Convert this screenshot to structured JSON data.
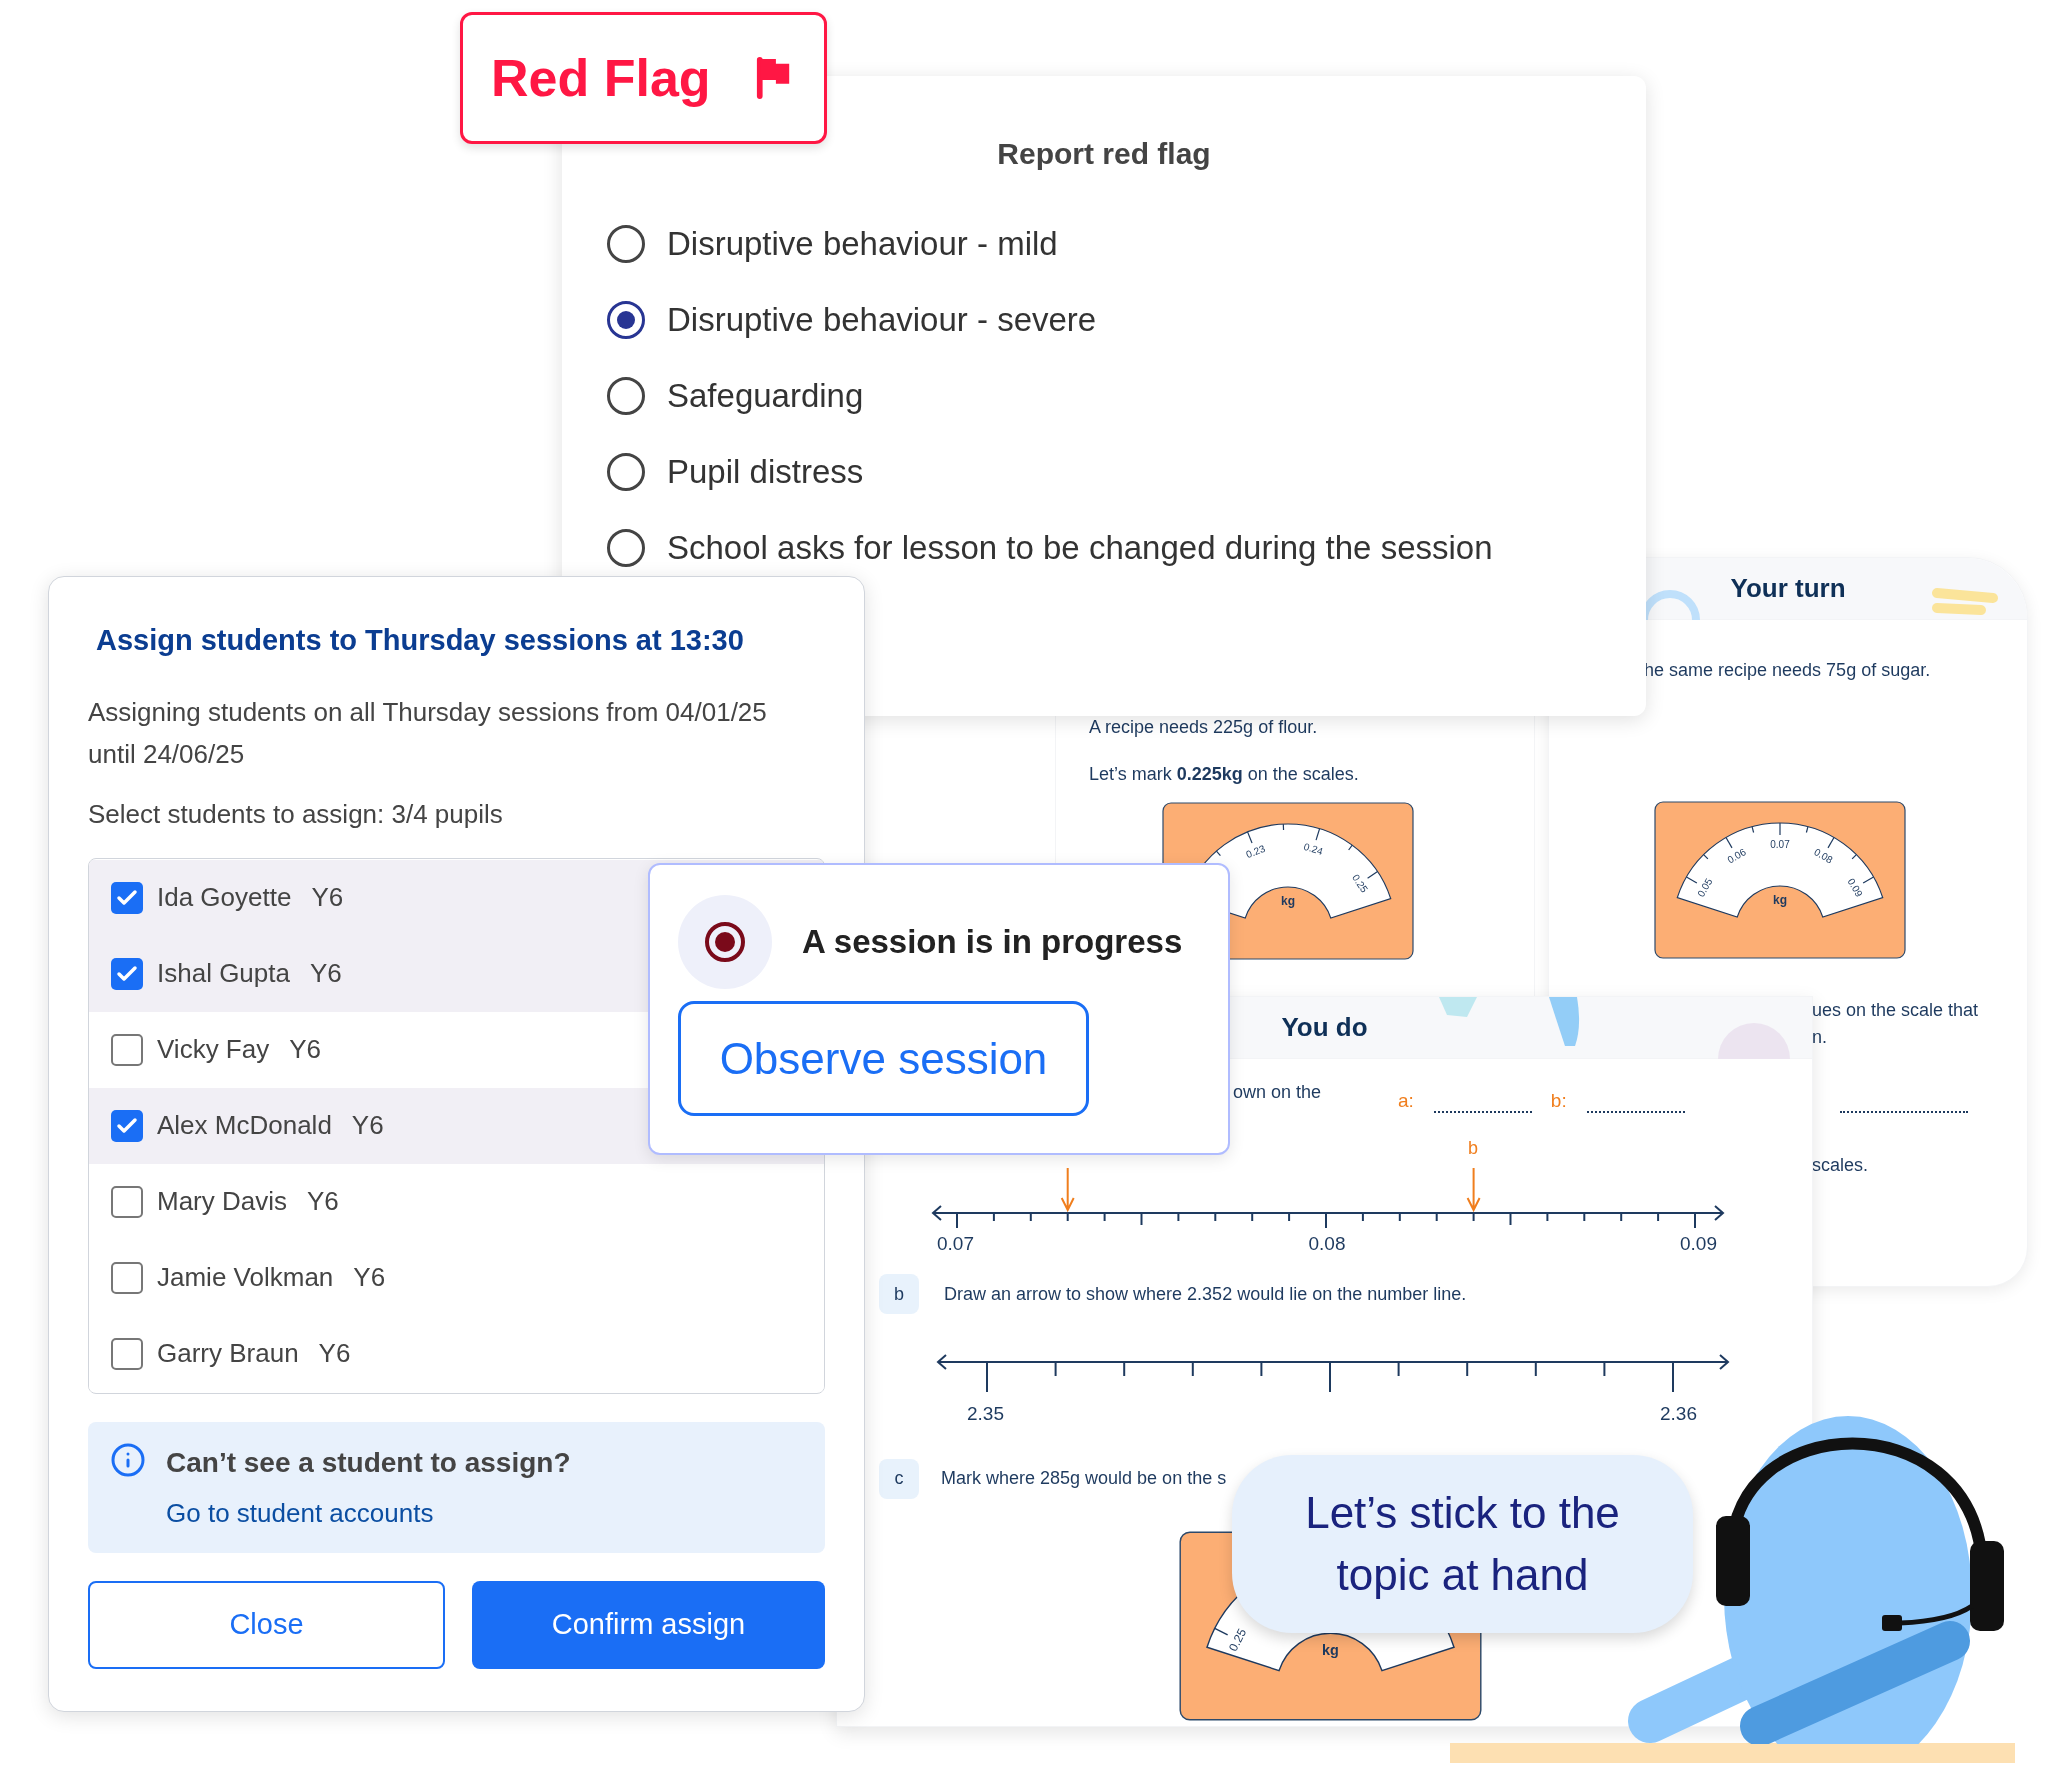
{
  "red_flag_badge": {
    "label": "Red Flag"
  },
  "report_dialog": {
    "title": "Report red flag",
    "options": [
      {
        "label": "Disruptive behaviour - mild",
        "selected": false
      },
      {
        "label": "Disruptive behaviour - severe",
        "selected": true
      },
      {
        "label": "Safeguarding",
        "selected": false
      },
      {
        "label": "Pupil distress",
        "selected": false
      },
      {
        "label": "School asks for lesson to be changed during the session",
        "selected": false
      }
    ]
  },
  "worksheet": {
    "your_turn": {
      "title": "Your turn",
      "prompt": "he same recipe needs 75g of sugar.",
      "scale": {
        "labels": [
          "0.05",
          "0.06",
          "0.07",
          "0.08",
          "0.09"
        ],
        "unit": "kg"
      },
      "lines": [
        "ues on the scale that",
        "n."
      ],
      "last_line": "scales."
    },
    "recipe_panel": {
      "lines": [
        "A recipe needs 225g of flour.",
        "Let’s mark **0.225kg** on the scales."
      ],
      "scale": {
        "labels": [
          "0.23",
          "0.24",
          "0.25"
        ],
        "unit": "kg"
      }
    },
    "you_do": {
      "title": "You do",
      "intro": "own on the",
      "answers": [
        {
          "label": "a:"
        },
        {
          "label": "b:"
        }
      ],
      "number_line_1": {
        "labels": [
          "0.07",
          "0.08",
          "0.09"
        ],
        "marks": [
          {
            "kind": "arrow"
          },
          {
            "kind": "labelled_arrow",
            "label": "b"
          }
        ]
      },
      "questions": [
        {
          "letter": "b",
          "text": "Draw an arrow to show where 2.352 would lie on the number line."
        },
        {
          "letter": "c",
          "text": "Mark where 285g would be on the s"
        }
      ],
      "number_line_2": {
        "labels": [
          "2.35",
          "2.36"
        ]
      },
      "scale": {
        "labels": [
          "0.25"
        ],
        "unit": "kg"
      }
    }
  },
  "assign_dialog": {
    "title": "Assign students to Thursday sessions at 13:30",
    "description": "Assigning students on all Thursday sessions from 04/01/25 until 24/06/25",
    "select_label": "Select students to assign: 3/4 pupils",
    "students": [
      {
        "name": "Ida Goyette",
        "year": "Y6",
        "checked": true
      },
      {
        "name": "Ishal Gupta",
        "year": "Y6",
        "checked": true
      },
      {
        "name": "Vicky Fay",
        "year": "Y6",
        "checked": false
      },
      {
        "name": "Alex McDonald",
        "year": "Y6",
        "checked": true
      },
      {
        "name": "Mary Davis",
        "year": "Y6",
        "checked": false
      },
      {
        "name": "Jamie Volkman",
        "year": "Y6",
        "checked": false
      },
      {
        "name": "Garry Braun",
        "year": "Y6",
        "checked": false
      }
    ],
    "info": {
      "title": "Can’t see a student to assign?",
      "link": "Go to student accounts"
    },
    "buttons": [
      {
        "label": "Close",
        "kind": "secondary"
      },
      {
        "label": "Confirm assign",
        "kind": "primary"
      }
    ]
  },
  "session_popup": {
    "title": "A session is in progress",
    "button": "Observe session"
  },
  "speech_bubble": {
    "text": "Let’s stick to the topic at hand"
  }
}
